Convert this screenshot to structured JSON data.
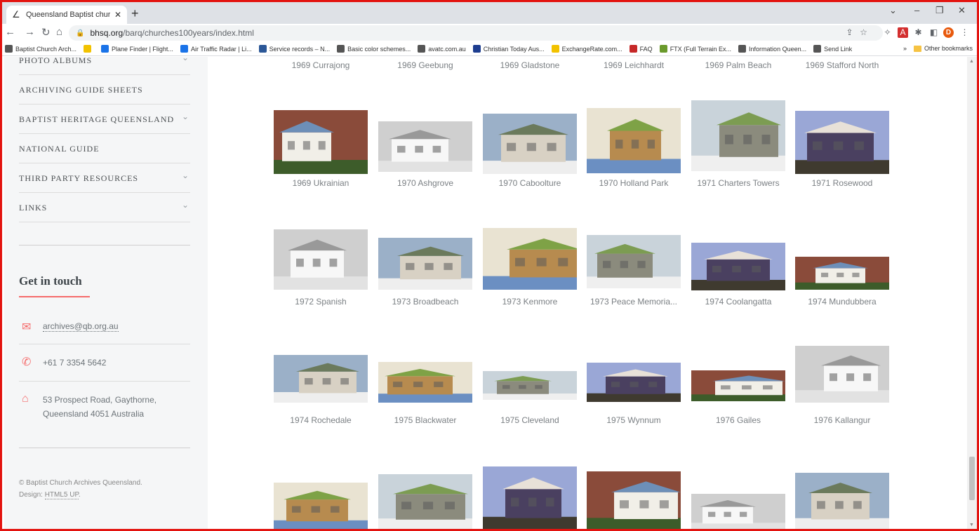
{
  "browser": {
    "tab_title": "Queensland Baptist churches by",
    "url_host": "bhsq.org",
    "url_path": "/barq/churches100years/index.html",
    "profile_initial": "D",
    "bookmarks": [
      {
        "label": "Baptist Church Arch...",
        "color": "#555"
      },
      {
        "label": "",
        "color": "#f2c200"
      },
      {
        "label": "Plane Finder | Flight...",
        "color": "#1a73e8"
      },
      {
        "label": "Air Traffic Radar | Li...",
        "color": "#1a73e8"
      },
      {
        "label": "Service records – N...",
        "color": "#2b5797"
      },
      {
        "label": "Basic color schemes...",
        "color": "#555"
      },
      {
        "label": "avatc.com.au",
        "color": "#555"
      },
      {
        "label": "Christian Today Aus...",
        "color": "#1d3d8f"
      },
      {
        "label": "ExchangeRate.com...",
        "color": "#f2c200"
      },
      {
        "label": "FAQ",
        "color": "#c62828"
      },
      {
        "label": "FTX (Full Terrain Ex...",
        "color": "#6a9a2c"
      },
      {
        "label": "Information Queen...",
        "color": "#555"
      },
      {
        "label": "Send Link",
        "color": "#555"
      }
    ],
    "other_bookmarks": "Other bookmarks"
  },
  "sidebar": {
    "nav": [
      {
        "label": "PHOTO ALBUMS",
        "chevron": true
      },
      {
        "label": "ARCHIVING GUIDE SHEETS",
        "chevron": false
      },
      {
        "label": "BAPTIST HERITAGE QUEENSLAND",
        "chevron": true
      },
      {
        "label": "NATIONAL GUIDE",
        "chevron": false
      },
      {
        "label": "THIRD PARTY RESOURCES",
        "chevron": true
      },
      {
        "label": "LINKS",
        "chevron": true
      }
    ],
    "get_in_touch": "Get in touch",
    "email": "archives@qb.org.au",
    "phone": "+61 7 3354 5642",
    "address_line1": "53 Prospect Road, Gaythorne,",
    "address_line2": "Queensland 4051 Australia",
    "footer_copy": "© Baptist Church Archives Queensland.",
    "footer_design_prefix": "Design: ",
    "footer_design_link": "HTML5 UP",
    "footer_design_suffix": "."
  },
  "gallery": {
    "top_captions": [
      "1969 Currajong",
      "1969 Geebung",
      "1969 Gladstone",
      "1969 Leichhardt",
      "1969 Palm Beach",
      "1969 Stafford North"
    ],
    "rows": [
      [
        "1969 Ukrainian",
        "1970 Ashgrove",
        "1970 Caboolture",
        "1970 Holland Park",
        "1971 Charters Towers",
        "1971 Rosewood"
      ],
      [
        "1972 Spanish",
        "1973 Broadbeach",
        "1973 Kenmore",
        "1973 Peace Memoria...",
        "1974 Coolangatta",
        "1974 Mundubbera"
      ],
      [
        "1974 Rochedale",
        "1975 Blackwater",
        "1975 Cleveland",
        "1975 Wynnum",
        "1976 Gailes",
        "1976 Kallangur"
      ]
    ]
  }
}
